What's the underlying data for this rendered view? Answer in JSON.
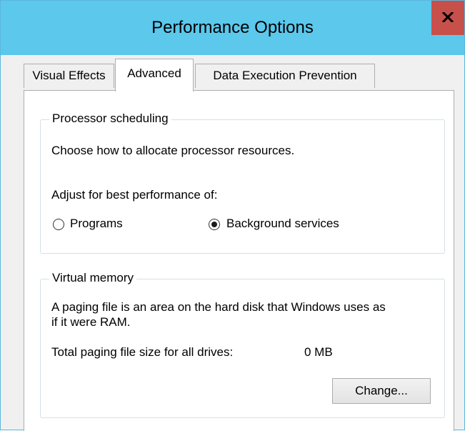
{
  "window": {
    "title": "Performance Options",
    "close_label": "x"
  },
  "tabs": [
    {
      "label": "Visual Effects",
      "selected": false
    },
    {
      "label": "Advanced",
      "selected": true
    },
    {
      "label": "Data Execution Prevention",
      "selected": false
    }
  ],
  "processor_scheduling": {
    "legend": "Processor scheduling",
    "description": "Choose how to allocate processor resources.",
    "adjust_label": "Adjust for best performance of:",
    "options": [
      {
        "label": "Programs",
        "checked": false
      },
      {
        "label": "Background services",
        "checked": true
      }
    ]
  },
  "virtual_memory": {
    "legend": "Virtual memory",
    "description_line1": "A paging file is an area on the hard disk that Windows uses as",
    "description_line2": "if it were RAM.",
    "total_label": "Total paging file size for all drives:",
    "total_value": "0 MB",
    "change_button": "Change..."
  }
}
